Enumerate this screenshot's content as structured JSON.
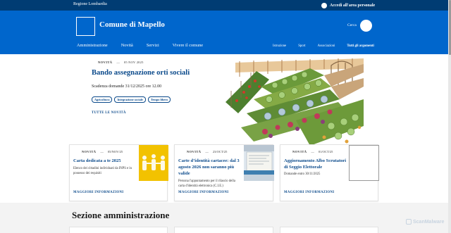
{
  "topbar": {
    "region": "Regione Lombardia",
    "login_label": "Accedi all'area personale"
  },
  "header": {
    "site_name": "Comune di Mapello",
    "search_label": "Cerca",
    "main_nav": [
      "Amministrazione",
      "Novità",
      "Servizi",
      "Vivere il comune"
    ],
    "sub_nav": [
      "Istruzione",
      "Sport",
      "Associazioni"
    ],
    "all_topics": "Tutti gli argomenti"
  },
  "hero": {
    "category": "NOVITÀ",
    "separator": "—",
    "date": "05 NOV 2025",
    "title": "Bando assegnazione orti sociali",
    "deadline": "Scadenza domande 31/12/2025 ore 12.00",
    "tags": [
      "Agricoltura",
      "Integrazione sociale",
      "Tempo libero"
    ],
    "all_news": "TUTTE LE NOVITÀ"
  },
  "cards": [
    {
      "category": "NOVITÀ",
      "date": "05/NOV/25",
      "title": "Carta dedicata a te 2025",
      "description": "Elenco dei cittadini individuati da INPS e in possesso dei requisiti",
      "more": "MAGGIORI INFORMAZIONI"
    },
    {
      "category": "NOVITÀ",
      "date": "23/OCT/25",
      "title": "Carte d’identità cartacee: dal 3 agosto 2026 non saranno più valide",
      "description": "Persona l'appuntamento per il rilascio della carta d'identità elettronica (C.I.E.)",
      "more": "MAGGIORI INFORMAZIONI"
    },
    {
      "category": "NOVITÀ",
      "date": "01/OCT/25",
      "title": "Aggiornamento Albo Scrutatori di Seggio Elettorale",
      "description": "Domande entro 30/11/2025",
      "more": "MAGGIORI INFORMAZIONI"
    }
  ],
  "section": {
    "title": "Sezione amministrazione"
  },
  "watermark": "ScanMalware",
  "colors": {
    "topbar": "#003c73",
    "header": "#0066cc",
    "link": "#0b4a8b"
  }
}
